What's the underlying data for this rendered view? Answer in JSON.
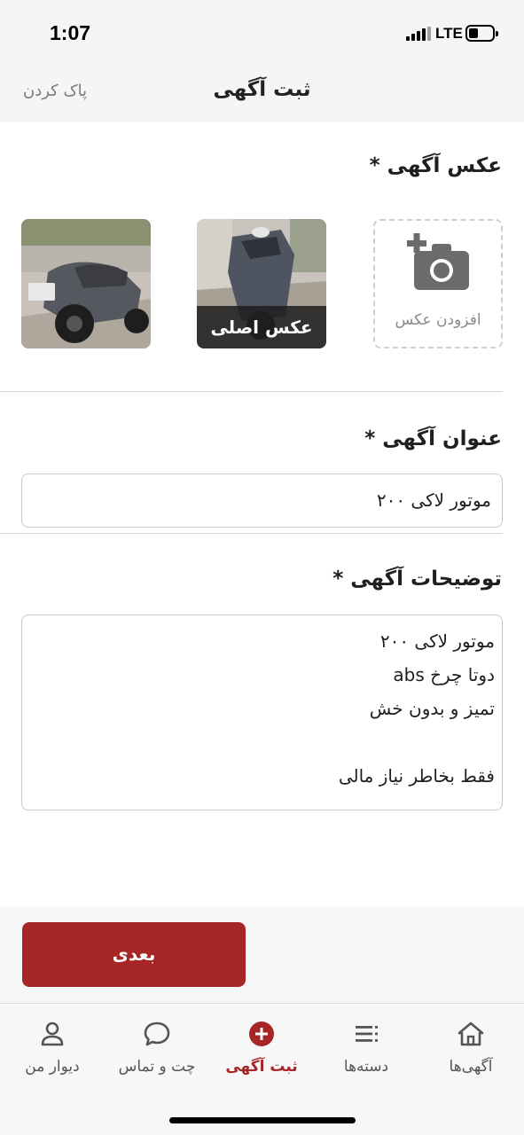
{
  "status_bar": {
    "time": "1:07",
    "network": "LTE"
  },
  "header": {
    "title": "ثبت آگهی",
    "clear_label": "پاک کردن"
  },
  "photos_section": {
    "title": "عکس آگهی *",
    "add_photo_label": "افزودن عکس",
    "main_photo_label": "عکس اصلی"
  },
  "title_section": {
    "title": "عنوان آگهی *",
    "value": "موتور لاکی ۲۰۰"
  },
  "description_section": {
    "title": "توضیحات آگهی *",
    "lines": [
      "موتور لاکی ۲۰۰",
      "دوتا چرخ abs",
      "تمیز و بدون خش",
      "",
      "فقط بخاطر نیاز مالی"
    ]
  },
  "next_button": {
    "label": "بعدی"
  },
  "bottom_nav": {
    "items": [
      {
        "label": "دیوار من",
        "icon": "user-icon"
      },
      {
        "label": "چت و تماس",
        "icon": "chat-icon"
      },
      {
        "label": "ثبت آگهی",
        "icon": "add-circle-icon"
      },
      {
        "label": "دسته‌ها",
        "icon": "categories-icon"
      },
      {
        "label": "آگهی‌ها",
        "icon": "home-icon"
      }
    ],
    "active_color": "#a62626"
  },
  "colors": {
    "accent": "#a62626",
    "background": "#f5f5f5"
  }
}
